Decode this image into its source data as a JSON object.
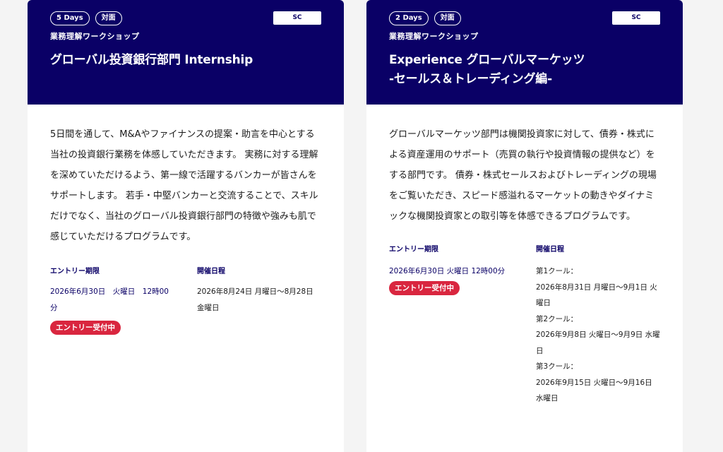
{
  "cards": [
    {
      "duration_tag": "5 Days",
      "format_tag": "対面",
      "badge": "SC",
      "category": "業務理解ワークショップ",
      "title_lines": [
        "グローバル投資銀行部門 Internship"
      ],
      "description": "5日間を通して、M&Aやファイナンスの提案・助言を中心とする当社の投資銀行業務を体感していただきます。 実務に対する理解を深めていただけるよう、第一線で活躍するバンカーが皆さんをサポートします。 若手・中堅バンカーと交流することで、スキルだけでなく、当社のグローバル投資銀行部門の特徴や強みも肌で感じていただけるプログラムです。",
      "entry_label": "エントリー期限",
      "entry_deadline": "2026年6月30日　火曜日　12時00分",
      "status": "エントリー受付中",
      "schedule_label": "開催日程",
      "schedule_lines": [
        "2026年8月24日 月曜日～8月28日 金曜日"
      ]
    },
    {
      "duration_tag": "2 Days",
      "format_tag": "対面",
      "badge": "SC",
      "category": "業務理解ワークショップ",
      "title_lines": [
        "Experience グローバルマーケッツ",
        "-セールス＆トレーディング編-"
      ],
      "description": "グローバルマーケッツ部門は機関投資家に対して、債券・株式による資産運用のサポート（売買の執行や投資情報の提供など）をする部門です。 債券・株式セールスおよびトレーディングの現場をご覧いただき、スピード感溢れるマーケットの動きやダイナミックな機関投資家との取引等を体感できるプログラムです。",
      "entry_label": "エントリー期限",
      "entry_deadline": "2026年6月30日 火曜日 12時00分",
      "status": "エントリー受付中",
      "schedule_label": "開催日程",
      "schedule_lines": [
        "第1クール：",
        "2026年8月31日 月曜日～9月1日 火曜日",
        "第2クール：",
        "2026年9月8日 火曜日～9月9日 水曜日",
        "第3クール：",
        "2026年9月15日 火曜日～9月16日 水曜日"
      ]
    }
  ],
  "colors": {
    "header_bg": "#0a0066",
    "status_badge": "#d9263f",
    "page_bg": "#f4f4f4"
  }
}
